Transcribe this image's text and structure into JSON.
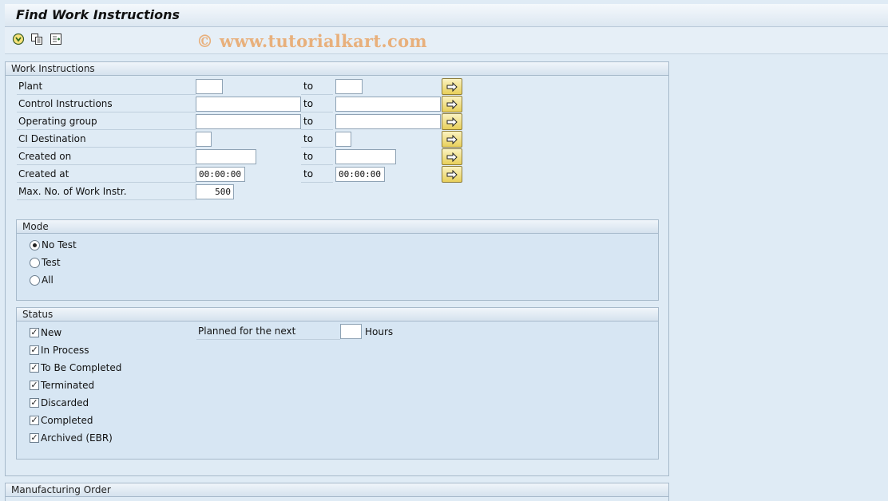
{
  "window": {
    "title": "Find Work Instructions",
    "watermark": "© www.tutorialkart.com"
  },
  "toolbar": {
    "icons": [
      "execute-icon",
      "copy-icon",
      "multiple-selection-icon"
    ]
  },
  "work_instructions": {
    "header": "Work Instructions",
    "to_label": "to",
    "rows": [
      {
        "label": "Plant",
        "from": "",
        "to": ""
      },
      {
        "label": "Control Instructions",
        "from": "",
        "to": ""
      },
      {
        "label": "Operating group",
        "from": "",
        "to": ""
      },
      {
        "label": "CI Destination",
        "from": "",
        "to": ""
      },
      {
        "label": "Created on",
        "from": "",
        "to": ""
      },
      {
        "label": "Created at",
        "from": "00:00:00",
        "to": "00:00:00"
      }
    ],
    "max_label": "Max. No. of Work Instr.",
    "max_value": "500"
  },
  "mode": {
    "header": "Mode",
    "options": [
      {
        "label": "No Test",
        "selected": true
      },
      {
        "label": "Test",
        "selected": false
      },
      {
        "label": "All",
        "selected": false
      }
    ]
  },
  "status": {
    "header": "Status",
    "items": [
      {
        "label": "New",
        "checked": true
      },
      {
        "label": "In Process",
        "checked": true
      },
      {
        "label": "To Be Completed",
        "checked": true
      },
      {
        "label": "Terminated",
        "checked": true
      },
      {
        "label": "Discarded",
        "checked": true
      },
      {
        "label": "Completed",
        "checked": true
      },
      {
        "label": "Archived (EBR)",
        "checked": true
      }
    ],
    "planned_label": "Planned for the next",
    "planned_value": "",
    "hours_label": "Hours"
  },
  "manufacturing_order": {
    "header": "Manufacturing Order"
  }
}
